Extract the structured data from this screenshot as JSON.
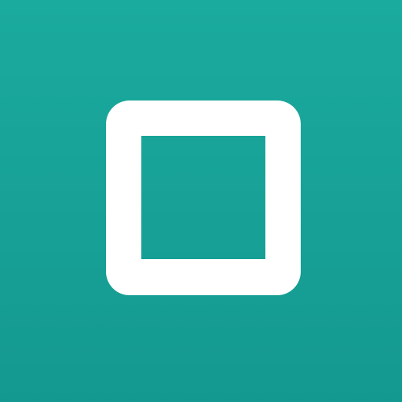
{
  "icon": {
    "name": "square-outline-icon",
    "background_top": "#1BAA9E",
    "background_bottom": "#149990",
    "glyph_color": "#FFFFFF"
  }
}
